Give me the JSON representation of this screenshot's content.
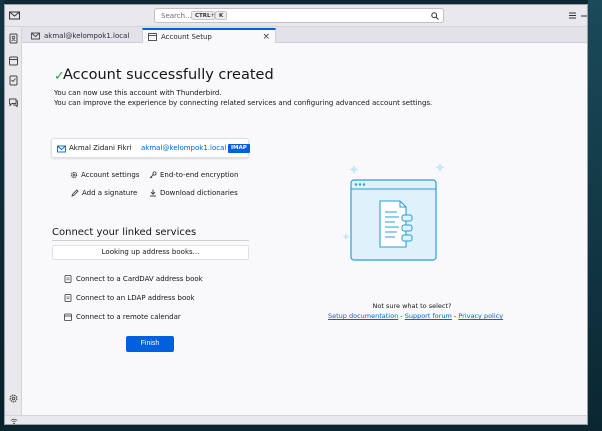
{
  "window": {
    "search_placeholder": "Search...",
    "search_shortcut_mod": "CTRL",
    "search_shortcut_plus": "+",
    "search_shortcut_key": "K"
  },
  "tabs": [
    {
      "label": "akmal@kelompok1.local",
      "icon": "mail-icon",
      "active": false
    },
    {
      "label": "Account Setup",
      "icon": "account-setup-icon",
      "active": true,
      "close": "×"
    }
  ],
  "main": {
    "heading": "Account successfully created",
    "desc_line1": "You can now use this account with Thunderbird.",
    "desc_line2": "You can improve the experience by connecting related services and configuring advanced account settings."
  },
  "account": {
    "name": "Akmal Zidani Fikri",
    "email": "akmal@kelompok1.local",
    "protocol": "IMAP"
  },
  "actions": {
    "account_settings": "Account settings",
    "e2e_encryption": "End-to-end encryption",
    "add_signature": "Add a signature",
    "download_dictionaries": "Download dictionaries"
  },
  "linked": {
    "title": "Connect your linked services",
    "loading": "Looking up address books...",
    "carddav": "Connect to a CardDAV address book",
    "ldap": "Connect to an LDAP address book",
    "calendar": "Connect to a remote calendar"
  },
  "finish_label": "Finish",
  "help": {
    "question": "Not sure what to select?",
    "setup_doc": "Setup documentation",
    "sep1": " - ",
    "support": "Support forum",
    "sep2": " - ",
    "privacy": "Privacy policy"
  },
  "colors": {
    "accent": "#0060df",
    "success": "#2ea44f"
  }
}
